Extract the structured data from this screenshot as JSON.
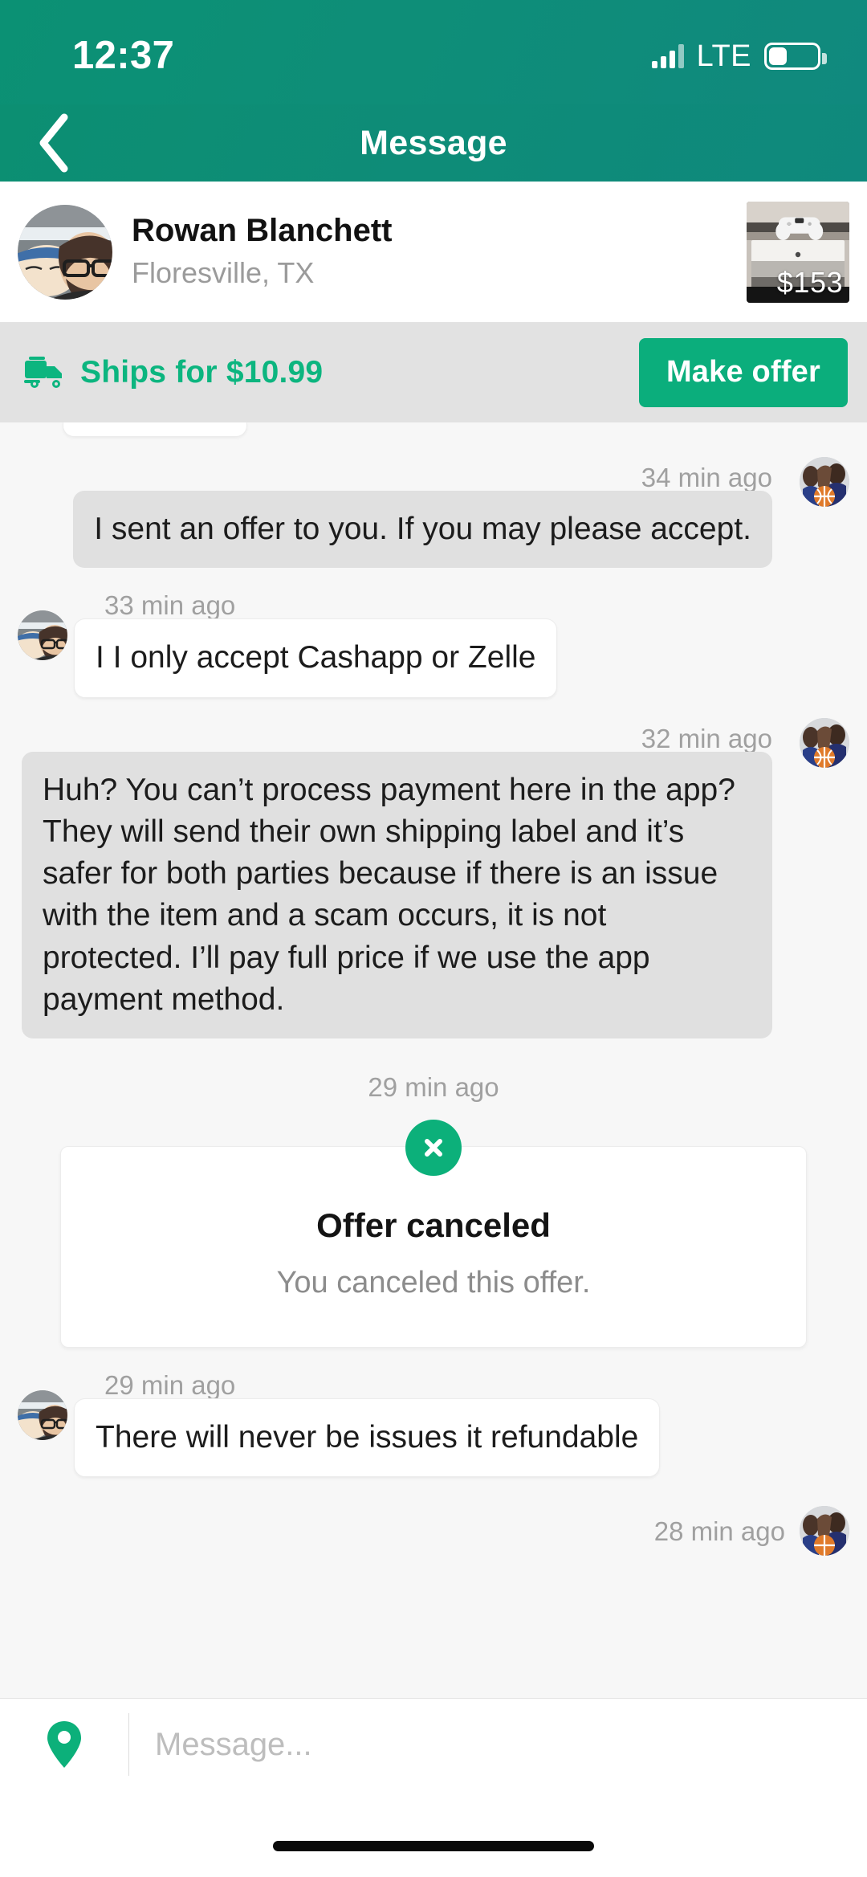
{
  "status_bar": {
    "time": "12:37",
    "network_label": "LTE",
    "signal_bars": 3,
    "signal_bars_total": 4,
    "battery_percent": 34
  },
  "nav": {
    "title": "Message",
    "back_icon": "chevron-left-icon"
  },
  "seller": {
    "name": "Rowan Blanchett",
    "location": "Floresville, TX",
    "avatar_icon": "seller-avatar",
    "product": {
      "price": "$153",
      "thumb_icon": "ps4-console-photo"
    }
  },
  "shipping": {
    "truck_icon": "shipping-truck-icon",
    "label": "Ships for $10.99",
    "make_offer_label": "Make offer"
  },
  "conversation": {
    "messages": [
      {
        "side": "right",
        "time": "34 min ago",
        "text": "I sent an offer to you. If you may please accept."
      },
      {
        "side": "left",
        "time": "33 min ago",
        "text": "I I only accept Cashapp or Zelle"
      },
      {
        "side": "right",
        "time": "32 min ago",
        "text": "Huh? You can’t process payment here in the app? They will send their own shipping label and it’s safer for both parties because if there is an issue with the item and a scam occurs, it is not protected. I’ll pay full price if we use the app payment method."
      },
      {
        "side": "left",
        "time": "29 min ago",
        "text": "There will never be issues it refundable"
      }
    ],
    "offer_card": {
      "time": "29 min ago",
      "icon": "x-circle-icon",
      "title": "Offer canceled",
      "subtitle": "You canceled this offer."
    },
    "trailing_time": "28 min ago"
  },
  "composer": {
    "location_icon": "location-pin-icon",
    "placeholder": "Message...",
    "value": ""
  },
  "colors": {
    "brand_green": "#0bae7c",
    "header_green": "#0c8f72",
    "ship_text_green": "#0cb57f",
    "bubble_me": "#e0e0e0",
    "bubble_them": "#ffffff"
  }
}
